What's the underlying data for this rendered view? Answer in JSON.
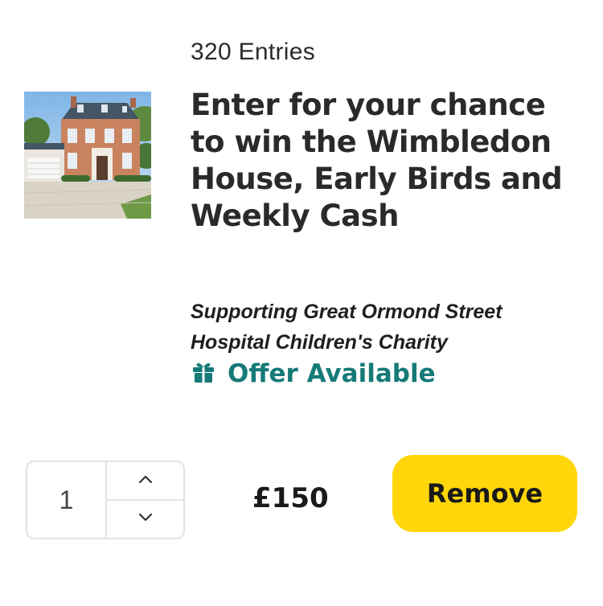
{
  "entry": {
    "entries_label": "320 Entries",
    "title": "Enter for your chance to win the Wimbledon House, Early Birds and Weekly Cash",
    "charity": "Supporting Great Ormond Street Hospital Children's Charity",
    "offer": {
      "icon": "gift-icon",
      "label": "Offer Available",
      "color": "#157a78"
    },
    "thumbnail_icon": "house-photo"
  },
  "quantity": {
    "value": "1",
    "increment_icon": "chevron-up-icon",
    "decrement_icon": "chevron-down-icon"
  },
  "price": "£150",
  "actions": {
    "remove_label": "Remove",
    "remove_color": "#ffd60a"
  }
}
